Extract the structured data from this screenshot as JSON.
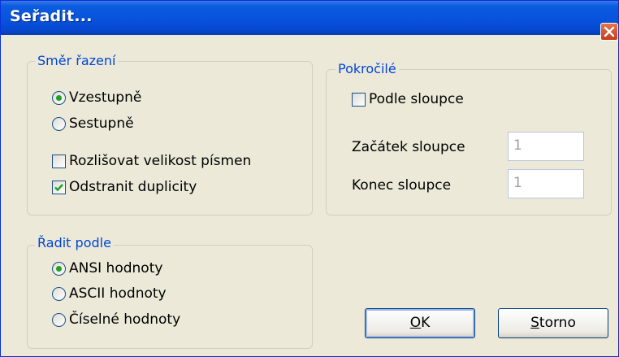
{
  "window": {
    "title": "Seřadit..."
  },
  "direction_group": {
    "legend": "Směr řazení",
    "ascending": "Vzestupně",
    "descending": "Sestupně",
    "selected": "Vzestupně"
  },
  "options": {
    "case_sensitive": {
      "label": "Rozlišovat velikost písmen",
      "checked": false
    },
    "remove_duplicates": {
      "label": "Odstranit duplicity",
      "checked": true
    }
  },
  "advanced_group": {
    "legend": "Pokročilé",
    "by_column": {
      "label": "Podle sloupce",
      "checked": false
    },
    "column_start_label": "Začátek sloupce",
    "column_start_value": "1",
    "column_end_label": "Konec sloupce",
    "column_end_value": "1"
  },
  "sort_by_group": {
    "legend": "Řadit podle",
    "ansi": "ANSI hodnoty",
    "ascii": "ASCII hodnoty",
    "numeric": "Číselné hodnoty",
    "selected": "ANSI hodnoty"
  },
  "buttons": {
    "ok_mnemonic": "O",
    "ok_rest": "K",
    "cancel_mnemonic": "S",
    "cancel_rest": "torno"
  },
  "colors": {
    "titlebar": "#0854dd",
    "legend_text": "#0046d5",
    "face": "#ece9d8"
  }
}
